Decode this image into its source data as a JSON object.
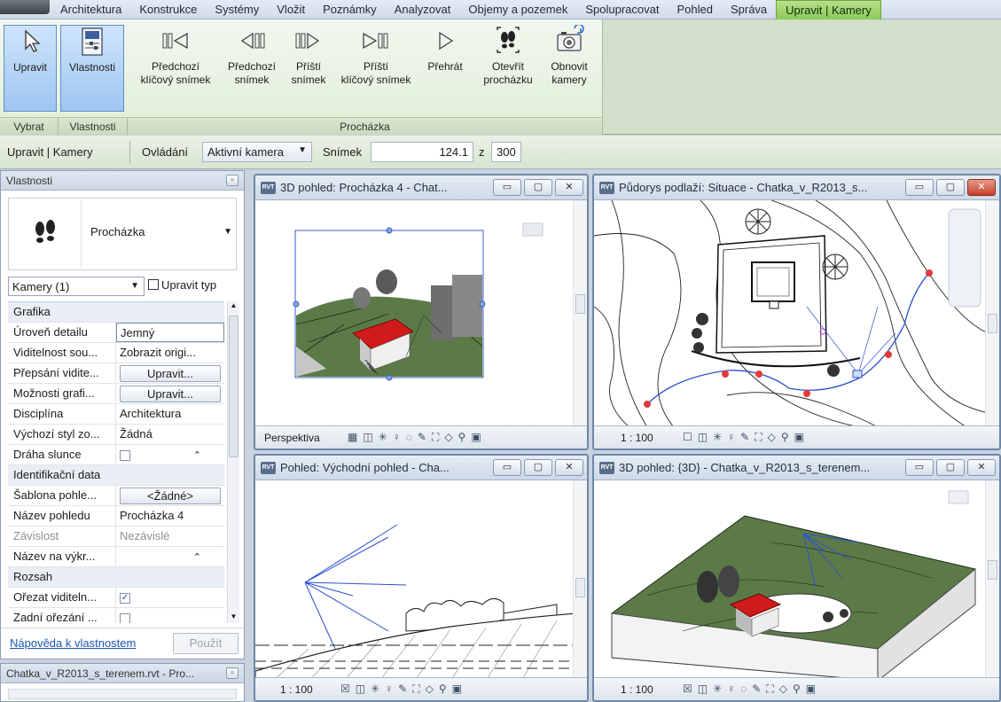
{
  "tabs": [
    "Architektura",
    "Konstrukce",
    "Systémy",
    "Vložit",
    "Poznámky",
    "Analyzovat",
    "Objemy a pozemek",
    "Spolupracovat",
    "Pohled",
    "Správa",
    "Upravit | Kamery"
  ],
  "ribbon": {
    "upravit": "Upravit",
    "vlastnosti": "Vlastnosti",
    "prev_key_1": "Předchozí",
    "prev_key_2": "klíčový snímek",
    "prev_1": "Předchozí",
    "prev_2": "snímek",
    "next_1": "Příští",
    "next_2": "snímek",
    "next_key_1": "Příští",
    "next_key_2": "klíčový snímek",
    "play": "Přehrát",
    "open_1": "Otevřít",
    "open_2": "procházku",
    "refresh_1": "Obnovit",
    "refresh_2": "kamery",
    "group_vybrat": "Vybrat",
    "group_vlastnosti": "Vlastnosti",
    "group_prochazka": "Procházka"
  },
  "options": {
    "context": "Upravit | Kamery",
    "ovladani_label": "Ovládání",
    "ovladani_value": "Aktivní kamera",
    "snimek_label": "Snímek",
    "snimek_value": "124.1",
    "z": "z",
    "total": "300"
  },
  "properties": {
    "title": "Vlastnosti",
    "type_name": "Procházka",
    "instance": "Kamery (1)",
    "edit_type": "Upravit typ",
    "rows": [
      {
        "k": "Grafika",
        "group": true
      },
      {
        "k": "Úroveň detailu",
        "v": "Jemný"
      },
      {
        "k": "Viditelnost sou...",
        "v": "Zobrazit origi..."
      },
      {
        "k": "Přepsání vidite...",
        "v": "Upravit...",
        "btn": true
      },
      {
        "k": "Možnosti grafi...",
        "v": "Upravit...",
        "btn": true
      },
      {
        "k": "Disciplína",
        "v": "Architektura"
      },
      {
        "k": "Výchozí styl zo...",
        "v": "Žádná"
      },
      {
        "k": "Dráha slunce",
        "chk": ""
      },
      {
        "k": "Identifikační data",
        "group": true
      },
      {
        "k": "Šablona pohle...",
        "v": "<Žádné>",
        "btn": true
      },
      {
        "k": "Název pohledu",
        "v": "Procházka 4"
      },
      {
        "k": "Závislost",
        "v": "Nezávislé",
        "gray": true
      },
      {
        "k": "Název na výkr...",
        "v": ""
      },
      {
        "k": "Rozsah",
        "group": true
      },
      {
        "k": "Ořezat viditeln...",
        "chk": "✓"
      },
      {
        "k": "Zadní ořezání ...",
        "chk": ""
      }
    ],
    "help": "Nápověda k vlastnostem",
    "apply": "Použít"
  },
  "browser": {
    "title": "Chatka_v_R2013_s_terenem.rvt - Pro..."
  },
  "views": {
    "v1": {
      "title": "3D pohled: Procházka 4 - Chat...",
      "status": "Perspektiva"
    },
    "v2": {
      "title": "Půdorys podlaží: Situace - Chatka_v_R2013_s...",
      "status": "1 : 100"
    },
    "v3": {
      "title": "Pohled: Východní pohled - Cha...",
      "status": "1 : 100"
    },
    "v4": {
      "title": "3D pohled: {3D} - Chatka_v_R2013_s_terenem...",
      "status": "1 : 100"
    }
  },
  "colors": {
    "ribbon_active": "#8cc95a",
    "roof": "#d11a1a",
    "terrain": "#5c7a48",
    "path": "#2b4fd1",
    "keyframe": "#e23a3a"
  }
}
